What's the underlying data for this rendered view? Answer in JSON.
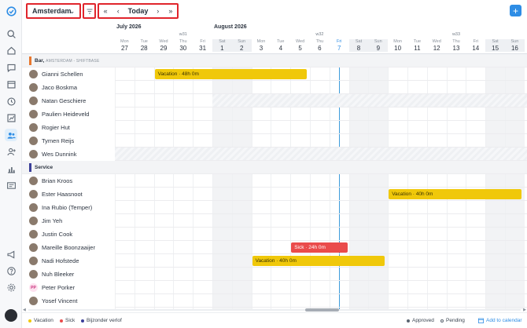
{
  "toolbar": {
    "location": "Amsterdam",
    "today_label": "Today",
    "nav_first": "«",
    "nav_prev": "‹",
    "nav_next": "›",
    "nav_last": "»",
    "add_label": "+"
  },
  "calendar": {
    "months": [
      {
        "label": "July 2026",
        "col": 0
      },
      {
        "label": "August 2026",
        "col": 5
      }
    ],
    "weeks": [
      {
        "label": "w31",
        "col": 3
      },
      {
        "label": "w32",
        "col": 10
      },
      {
        "label": "w33",
        "col": 17
      }
    ],
    "days": [
      {
        "dn": "Mon",
        "dd": "27",
        "weekend": false
      },
      {
        "dn": "Tue",
        "dd": "28",
        "weekend": false
      },
      {
        "dn": "Wed",
        "dd": "29",
        "weekend": false
      },
      {
        "dn": "Thu",
        "dd": "30",
        "weekend": false
      },
      {
        "dn": "Fri",
        "dd": "31",
        "weekend": false
      },
      {
        "dn": "Sat",
        "dd": "1",
        "weekend": true
      },
      {
        "dn": "Sun",
        "dd": "2",
        "weekend": true
      },
      {
        "dn": "Mon",
        "dd": "3",
        "weekend": false
      },
      {
        "dn": "Tue",
        "dd": "4",
        "weekend": false
      },
      {
        "dn": "Wed",
        "dd": "5",
        "weekend": false
      },
      {
        "dn": "Thu",
        "dd": "6",
        "weekend": false
      },
      {
        "dn": "Fri",
        "dd": "7",
        "weekend": false,
        "today": true
      },
      {
        "dn": "Sat",
        "dd": "8",
        "weekend": true
      },
      {
        "dn": "Sun",
        "dd": "9",
        "weekend": true
      },
      {
        "dn": "Mon",
        "dd": "10",
        "weekend": false
      },
      {
        "dn": "Tue",
        "dd": "11",
        "weekend": false
      },
      {
        "dn": "Wed",
        "dd": "12",
        "weekend": false
      },
      {
        "dn": "Thu",
        "dd": "13",
        "weekend": false
      },
      {
        "dn": "Fri",
        "dd": "14",
        "weekend": false
      },
      {
        "dn": "Sat",
        "dd": "15",
        "weekend": true
      },
      {
        "dn": "Sun",
        "dd": "16",
        "weekend": true
      }
    ]
  },
  "groups": [
    {
      "title": "Bar",
      "subtitle": "AMSTERDAM - SHIFTBASE",
      "color": "#e8772e",
      "members": [
        {
          "name": "Gianni Schellen",
          "events": [
            {
              "type": "vacation",
              "label": "Vacation · 48h 0m",
              "start": 2,
              "end": 9.8
            }
          ]
        },
        {
          "name": "Jaco Boskma",
          "events": []
        },
        {
          "name": "Natan Geschiere",
          "blocked_from": 5,
          "events": []
        },
        {
          "name": "Paulien Heideveld",
          "events": []
        },
        {
          "name": "Rogier Hut",
          "events": []
        },
        {
          "name": "Tymen Reijs",
          "events": []
        },
        {
          "name": "Wes Dunnink",
          "blocked_from": 0,
          "events": []
        }
      ]
    },
    {
      "title": "Service",
      "subtitle": "",
      "color": "#3b3f99",
      "members": [
        {
          "name": "Brian Kroos",
          "events": []
        },
        {
          "name": "Ester Haasnoot",
          "events": [
            {
              "type": "vacation",
              "label": "Vacation · 40h 0m",
              "start": 14,
              "end": 20.8
            }
          ]
        },
        {
          "name": "Ina Rubio (Temper)",
          "events": []
        },
        {
          "name": "Jim Yeh",
          "events": []
        },
        {
          "name": "Justin Cook",
          "events": []
        },
        {
          "name": "Mareille Boonzaaijer",
          "events": [
            {
              "type": "sick",
              "label": "Sick · 24h 0m",
              "start": 9,
              "end": 11.9
            }
          ]
        },
        {
          "name": "Nadi Hofstede",
          "events": [
            {
              "type": "vacation",
              "label": "Vacation · 40h 0m",
              "start": 7,
              "end": 13.8
            }
          ]
        },
        {
          "name": "Nuh Bleeker",
          "events": []
        },
        {
          "name": "Peter Porker",
          "initials": "PP",
          "events": []
        },
        {
          "name": "Yosef Vincent",
          "events": []
        }
      ]
    }
  ],
  "legend": {
    "vacation": "Vacation",
    "sick": "Sick",
    "bijzonder": "Bijzonder verlof",
    "approved": "Approved",
    "pending": "Pending",
    "add_to_calendar": "Add to calendar"
  },
  "colors": {
    "vacation": "#f0c80a",
    "sick": "#ea4b4b",
    "bijzonder": "#3b3f99",
    "accent": "#2e8de5",
    "today_line": "#3d9cdb"
  },
  "icons": [
    "logo-icon",
    "search-icon",
    "home-icon",
    "chat-icon",
    "calendar-icon",
    "clock-icon",
    "chart-icon",
    "team-icon",
    "user-add-icon",
    "bar-chart-icon",
    "id-card-icon",
    "megaphone-icon",
    "help-icon",
    "settings-icon"
  ]
}
